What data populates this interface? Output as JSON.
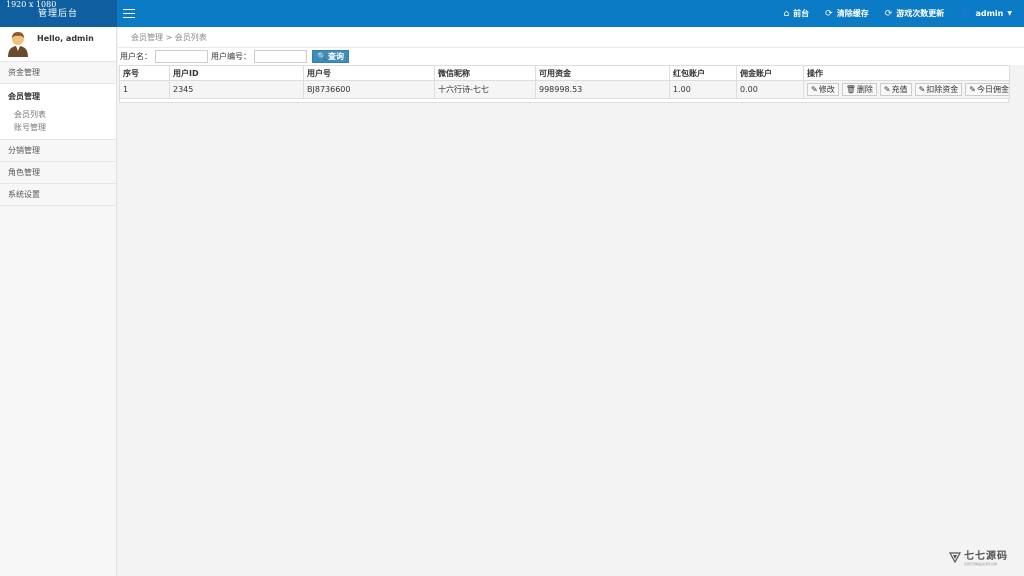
{
  "header": {
    "logo_line1": "1920 x 1080",
    "logo_line2": "管理后台",
    "nav": [
      {
        "icon": "home-icon",
        "glyph": "⌂",
        "label": "前台"
      },
      {
        "icon": "refresh-icon",
        "glyph": "⟳",
        "label": "清除缓存"
      },
      {
        "icon": "refresh-icon",
        "glyph": "⟳",
        "label": "游戏次数更新"
      },
      {
        "icon": "user-icon",
        "glyph": "👤",
        "label": "admin"
      }
    ]
  },
  "sidebar": {
    "greeting": "Hello, admin",
    "groups": [
      {
        "label": "资金管理"
      },
      {
        "label": "会员管理",
        "items": [
          "会员列表",
          "账号管理"
        ]
      },
      {
        "label": "分销管理"
      },
      {
        "label": "角色管理"
      },
      {
        "label": "系统设置"
      }
    ]
  },
  "breadcrumb": {
    "text": "会员管理 > 会员列表"
  },
  "search": {
    "username_label": "用户名：",
    "userid_label": "用户编号：",
    "username_value": "",
    "userid_value": "",
    "button_label": "查询"
  },
  "table": {
    "columns": [
      "序号",
      "用户ID",
      "用户号",
      "微信昵称",
      "可用资金",
      "红包账户",
      "佣金账户",
      "操作"
    ],
    "rows": [
      {
        "index": "1",
        "user_id": "2345",
        "user_no": "BJ8736600",
        "nickname": "十六行诗-七七",
        "balance": "998998.53",
        "red_packet": "1.00",
        "commission": "0.00"
      }
    ],
    "actions": [
      "修改",
      "删除",
      "充值",
      "扣除资金",
      "今日佣金"
    ]
  },
  "watermark": {
    "name": "七七源码",
    "sub": "全网开源精品资源平台网"
  },
  "colors": {
    "topbar": "#0b7bc5",
    "logo_bg": "#0f5fa0",
    "search_btn": "#3c8dbc"
  }
}
